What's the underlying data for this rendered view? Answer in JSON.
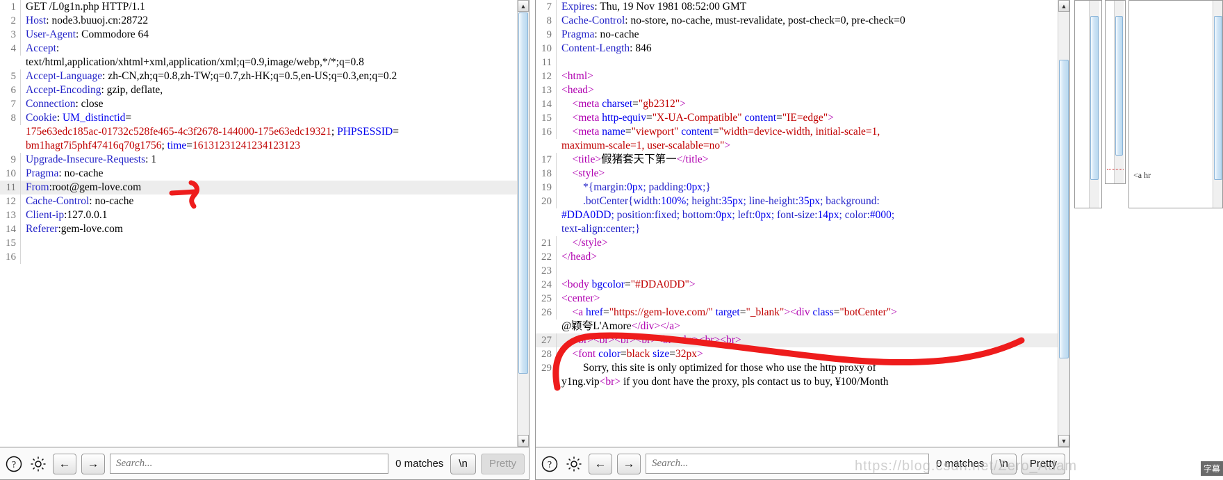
{
  "left_panel": {
    "name": "http-request-viewer",
    "lines": [
      {
        "n": "1",
        "segs": [
          {
            "t": "GET /L0g1n.php HTTP/1.1",
            "c": "v"
          }
        ]
      },
      {
        "n": "2",
        "segs": [
          {
            "t": "Host",
            "c": "k"
          },
          {
            "t": ": node3.buuoj.cn:28722",
            "c": "v"
          }
        ]
      },
      {
        "n": "3",
        "segs": [
          {
            "t": "User-Agent",
            "c": "k"
          },
          {
            "t": ": Commodore 64",
            "c": "v"
          }
        ]
      },
      {
        "n": "4",
        "segs": [
          {
            "t": "Accept",
            "c": "k"
          },
          {
            "t": ":\ntext/html,application/xhtml+xml,application/xml;q=0.9,image/webp,*/*;q=0.8",
            "c": "v"
          }
        ]
      },
      {
        "n": "5",
        "segs": [
          {
            "t": "Accept-Language",
            "c": "k"
          },
          {
            "t": ": zh-CN,zh;q=0.8,zh-TW;q=0.7,zh-HK;q=0.5,en-US;q=0.3,en;q=0.2",
            "c": "v"
          }
        ]
      },
      {
        "n": "6",
        "segs": [
          {
            "t": "Accept-Encoding",
            "c": "k"
          },
          {
            "t": ": gzip, deflate,",
            "c": "v"
          }
        ]
      },
      {
        "n": "7",
        "segs": [
          {
            "t": "Connection",
            "c": "k"
          },
          {
            "t": ": close",
            "c": "v"
          }
        ]
      },
      {
        "n": "8",
        "segs": [
          {
            "t": "Cookie",
            "c": "k"
          },
          {
            "t": ": ",
            "c": "v"
          },
          {
            "t": "UM_distinctid",
            "c": "b"
          },
          {
            "t": "=\n",
            "c": "v"
          },
          {
            "t": "175e63edc185ac-01732c528fe465-4c3f2678-144000-175e63edc19321",
            "c": "r"
          },
          {
            "t": "; ",
            "c": "v"
          },
          {
            "t": "PHPSESSID",
            "c": "b"
          },
          {
            "t": "=\n",
            "c": "v"
          },
          {
            "t": "bm1hagt7i5phf47416q70g1756",
            "c": "r"
          },
          {
            "t": "; ",
            "c": "v"
          },
          {
            "t": "time",
            "c": "b"
          },
          {
            "t": "=",
            "c": "v"
          },
          {
            "t": "16131231241234123123",
            "c": "r"
          }
        ]
      },
      {
        "n": "9",
        "segs": [
          {
            "t": "Upgrade-Insecure-Requests",
            "c": "k"
          },
          {
            "t": ": 1",
            "c": "v"
          }
        ]
      },
      {
        "n": "10",
        "segs": [
          {
            "t": "Pragma",
            "c": "k"
          },
          {
            "t": ": no-cache",
            "c": "v"
          }
        ]
      },
      {
        "n": "11",
        "hl": true,
        "segs": [
          {
            "t": "From",
            "c": "k"
          },
          {
            "t": ":root@gem-love.com",
            "c": "v"
          }
        ]
      },
      {
        "n": "12",
        "segs": [
          {
            "t": "Cache-Control",
            "c": "k"
          },
          {
            "t": ": no-cache",
            "c": "v"
          }
        ]
      },
      {
        "n": "13",
        "segs": [
          {
            "t": "Client-ip",
            "c": "k"
          },
          {
            "t": ":127.0.0.1",
            "c": "v"
          }
        ]
      },
      {
        "n": "14",
        "segs": [
          {
            "t": "Referer",
            "c": "k"
          },
          {
            "t": ":gem-love.com",
            "c": "v"
          }
        ]
      },
      {
        "n": "15",
        "segs": [
          {
            "t": "",
            "c": "v"
          }
        ]
      },
      {
        "n": "16",
        "segs": [
          {
            "t": "",
            "c": "v"
          }
        ]
      }
    ],
    "toolbar": {
      "help_icon": "question-mark-icon",
      "settings_icon": "gear-icon",
      "prev_label": "←",
      "next_label": "→",
      "search_placeholder": "Search...",
      "search_value": "",
      "matches_label": "0 matches",
      "newline_label": "\\n",
      "pretty_label": "Pretty",
      "pretty_disabled": true
    }
  },
  "right_panel": {
    "name": "http-response-viewer",
    "lines": [
      {
        "n": "7",
        "segs": [
          {
            "t": "Expires",
            "c": "k"
          },
          {
            "t": ": Thu, 19 Nov 1981 08:52:00 GMT",
            "c": "v"
          }
        ]
      },
      {
        "n": "8",
        "segs": [
          {
            "t": "Cache-Control",
            "c": "k"
          },
          {
            "t": ": no-store, no-cache, must-revalidate, post-check=0, pre-check=0",
            "c": "v"
          }
        ]
      },
      {
        "n": "9",
        "segs": [
          {
            "t": "Pragma",
            "c": "k"
          },
          {
            "t": ": no-cache",
            "c": "v"
          }
        ]
      },
      {
        "n": "10",
        "segs": [
          {
            "t": "Content-Length",
            "c": "k"
          },
          {
            "t": ": 846",
            "c": "v"
          }
        ]
      },
      {
        "n": "11",
        "segs": [
          {
            "t": "",
            "c": "v"
          }
        ]
      },
      {
        "n": "12",
        "segs": [
          {
            "t": "<html>",
            "c": "m"
          }
        ]
      },
      {
        "n": "13",
        "segs": [
          {
            "t": "<head>",
            "c": "m"
          }
        ]
      },
      {
        "n": "14",
        "segs": [
          {
            "t": "    ",
            "c": "v"
          },
          {
            "t": "<meta ",
            "c": "m"
          },
          {
            "t": "charset",
            "c": "b"
          },
          {
            "t": "=",
            "c": "v"
          },
          {
            "t": "\"gb2312\"",
            "c": "r"
          },
          {
            "t": ">",
            "c": "m"
          }
        ]
      },
      {
        "n": "15",
        "segs": [
          {
            "t": "    ",
            "c": "v"
          },
          {
            "t": "<meta ",
            "c": "m"
          },
          {
            "t": "http-equiv",
            "c": "b"
          },
          {
            "t": "=",
            "c": "v"
          },
          {
            "t": "\"X-UA-Compatible\"",
            "c": "r"
          },
          {
            "t": " ",
            "c": "v"
          },
          {
            "t": "content",
            "c": "b"
          },
          {
            "t": "=",
            "c": "v"
          },
          {
            "t": "\"IE=edge\"",
            "c": "r"
          },
          {
            "t": ">",
            "c": "m"
          }
        ]
      },
      {
        "n": "16",
        "segs": [
          {
            "t": "    ",
            "c": "v"
          },
          {
            "t": "<meta ",
            "c": "m"
          },
          {
            "t": "name",
            "c": "b"
          },
          {
            "t": "=",
            "c": "v"
          },
          {
            "t": "\"viewport\"",
            "c": "r"
          },
          {
            "t": " ",
            "c": "v"
          },
          {
            "t": "content",
            "c": "b"
          },
          {
            "t": "=",
            "c": "v"
          },
          {
            "t": "\"width=device-width, initial-scale=1,\nmaximum-scale=1, user-scalable=no\"",
            "c": "r"
          },
          {
            "t": ">",
            "c": "m"
          }
        ]
      },
      {
        "n": "17",
        "segs": [
          {
            "t": "    ",
            "c": "v"
          },
          {
            "t": "<title>",
            "c": "m"
          },
          {
            "t": "假猪套天下第一",
            "c": "v"
          },
          {
            "t": "</title>",
            "c": "m"
          }
        ]
      },
      {
        "n": "18",
        "segs": [
          {
            "t": "    ",
            "c": "v"
          },
          {
            "t": "<style>",
            "c": "m"
          }
        ]
      },
      {
        "n": "19",
        "segs": [
          {
            "t": "        ",
            "c": "v"
          },
          {
            "t": "*{margin:",
            "c": "k"
          },
          {
            "t": "0px",
            "c": "b"
          },
          {
            "t": "; padding:",
            "c": "k"
          },
          {
            "t": "0px",
            "c": "b"
          },
          {
            "t": ";}",
            "c": "k"
          }
        ]
      },
      {
        "n": "20",
        "segs": [
          {
            "t": "        ",
            "c": "v"
          },
          {
            "t": ".botCenter{width:",
            "c": "k"
          },
          {
            "t": "100%",
            "c": "b"
          },
          {
            "t": "; height:",
            "c": "k"
          },
          {
            "t": "35px",
            "c": "b"
          },
          {
            "t": "; line-height:",
            "c": "k"
          },
          {
            "t": "35px",
            "c": "b"
          },
          {
            "t": "; background:\n",
            "c": "k"
          },
          {
            "t": "#DDA0DD",
            "c": "b"
          },
          {
            "t": "; position:fixed; bottom:",
            "c": "k"
          },
          {
            "t": "0px",
            "c": "b"
          },
          {
            "t": "; left:",
            "c": "k"
          },
          {
            "t": "0px",
            "c": "b"
          },
          {
            "t": "; font-size:",
            "c": "k"
          },
          {
            "t": "14px",
            "c": "b"
          },
          {
            "t": "; color:",
            "c": "k"
          },
          {
            "t": "#000",
            "c": "b"
          },
          {
            "t": ";\ntext-align:center;}",
            "c": "k"
          }
        ]
      },
      {
        "n": "21",
        "segs": [
          {
            "t": "    ",
            "c": "v"
          },
          {
            "t": "</style>",
            "c": "m"
          }
        ]
      },
      {
        "n": "22",
        "segs": [
          {
            "t": "</head>",
            "c": "m"
          }
        ]
      },
      {
        "n": "23",
        "segs": [
          {
            "t": "",
            "c": "v"
          }
        ]
      },
      {
        "n": "24",
        "segs": [
          {
            "t": "<body ",
            "c": "m"
          },
          {
            "t": "bgcolor",
            "c": "b"
          },
          {
            "t": "=",
            "c": "v"
          },
          {
            "t": "\"#DDA0DD\"",
            "c": "r"
          },
          {
            "t": ">",
            "c": "m"
          }
        ]
      },
      {
        "n": "25",
        "segs": [
          {
            "t": "<center>",
            "c": "m"
          }
        ]
      },
      {
        "n": "26",
        "segs": [
          {
            "t": "    ",
            "c": "v"
          },
          {
            "t": "<a ",
            "c": "m"
          },
          {
            "t": "href",
            "c": "b"
          },
          {
            "t": "=",
            "c": "v"
          },
          {
            "t": "\"https://gem-love.com/\"",
            "c": "r"
          },
          {
            "t": " ",
            "c": "v"
          },
          {
            "t": "target",
            "c": "b"
          },
          {
            "t": "=",
            "c": "v"
          },
          {
            "t": "\"_blank\"",
            "c": "r"
          },
          {
            "t": ">",
            "c": "m"
          },
          {
            "t": "<div ",
            "c": "m"
          },
          {
            "t": "class",
            "c": "b"
          },
          {
            "t": "=",
            "c": "v"
          },
          {
            "t": "\"botCenter\"",
            "c": "r"
          },
          {
            "t": ">\n",
            "c": "m"
          },
          {
            "t": "@颖夸L'Amore",
            "c": "v"
          },
          {
            "t": "</div></a>",
            "c": "m"
          }
        ]
      },
      {
        "n": "27",
        "hl": true,
        "segs": [
          {
            "t": "    ",
            "c": "v"
          },
          {
            "t": "<br><br><br><br><br><br><br><br>",
            "c": "m"
          }
        ]
      },
      {
        "n": "28",
        "segs": [
          {
            "t": "    ",
            "c": "v"
          },
          {
            "t": "<font ",
            "c": "m"
          },
          {
            "t": "color",
            "c": "b"
          },
          {
            "t": "=",
            "c": "v"
          },
          {
            "t": "black ",
            "c": "r"
          },
          {
            "t": "size",
            "c": "b"
          },
          {
            "t": "=",
            "c": "v"
          },
          {
            "t": "32px",
            "c": "r"
          },
          {
            "t": ">",
            "c": "m"
          }
        ]
      },
      {
        "n": "29",
        "segs": [
          {
            "t": "        Sorry, this site is only optimized for those who use the http proxy of\ny1ng.vip",
            "c": "v"
          },
          {
            "t": "<br>",
            "c": "m"
          },
          {
            "t": " if you dont have the proxy, pls contact us to buy, ¥100/Month",
            "c": "v"
          }
        ]
      }
    ],
    "toolbar": {
      "help_icon": "question-mark-icon",
      "settings_icon": "gear-icon",
      "prev_label": "←",
      "next_label": "→",
      "search_placeholder": "Search...",
      "search_value": "",
      "matches_label": "0 matches",
      "newline_label": "\\n",
      "pretty_label": "Pretty",
      "pretty_disabled": false
    }
  },
  "annotations": {
    "left_arrow_name": "red-arrow-annotation",
    "right_curve_name": "red-curve-annotation",
    "color": "#ee1c1c"
  },
  "watermark": {
    "text": "https://blog.csdn.net/Zero_Adam",
    "badge": "字幕"
  },
  "colors": {
    "header_name": "#2424c8",
    "string_red": "#c00000",
    "tag_magenta": "#b000b0",
    "number_blue": "#0000ee",
    "annotation_red": "#ee1c1c"
  }
}
